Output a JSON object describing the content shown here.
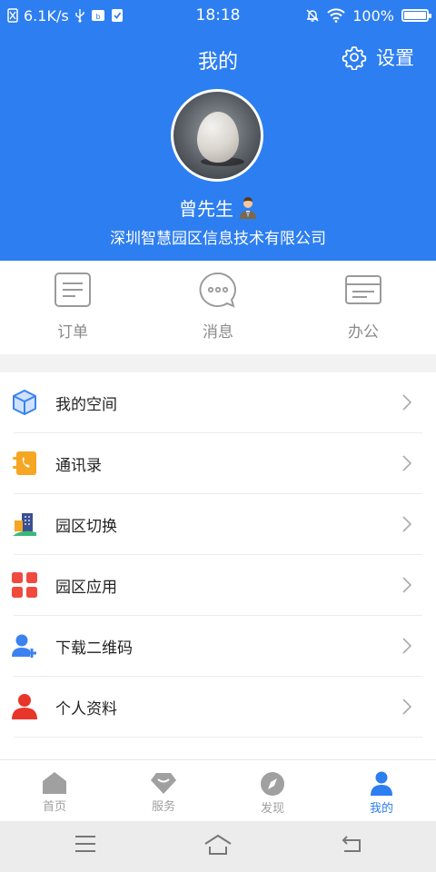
{
  "status_bar": {
    "network_speed": "6.1K/s",
    "time": "18:18",
    "battery": "100%",
    "battery_level": 1.0,
    "icons": [
      "sim-icon",
      "usb-icon",
      "hd-icon",
      "check-icon",
      "silent-bell-icon",
      "wifi-icon",
      "battery-icon"
    ]
  },
  "header": {
    "title": "我的",
    "settings_label": "设置",
    "username": "曾先生",
    "company": "深圳智慧园区信息技术有限公司"
  },
  "quick_actions": [
    {
      "label": "订单",
      "icon": "order-icon"
    },
    {
      "label": "消息",
      "icon": "message-icon"
    },
    {
      "label": "办公",
      "icon": "office-icon"
    }
  ],
  "menu": [
    {
      "label": "我的空间",
      "icon": "cube-icon"
    },
    {
      "label": "通讯录",
      "icon": "contacts-icon"
    },
    {
      "label": "园区切换",
      "icon": "park-switch-icon"
    },
    {
      "label": "园区应用",
      "icon": "apps-grid-icon"
    },
    {
      "label": "下载二维码",
      "icon": "add-user-icon"
    },
    {
      "label": "个人资料",
      "icon": "person-icon"
    }
  ],
  "tabs": [
    {
      "label": "首页",
      "icon": "home-icon",
      "active": false
    },
    {
      "label": "服务",
      "icon": "service-icon",
      "active": false
    },
    {
      "label": "发现",
      "icon": "discover-icon",
      "active": false
    },
    {
      "label": "我的",
      "icon": "profile-icon",
      "active": true
    }
  ],
  "colors": {
    "brand_blue": "#2d7ef0",
    "tab_inactive": "#a0a0a0",
    "page_bg": "#f2f2f2"
  }
}
